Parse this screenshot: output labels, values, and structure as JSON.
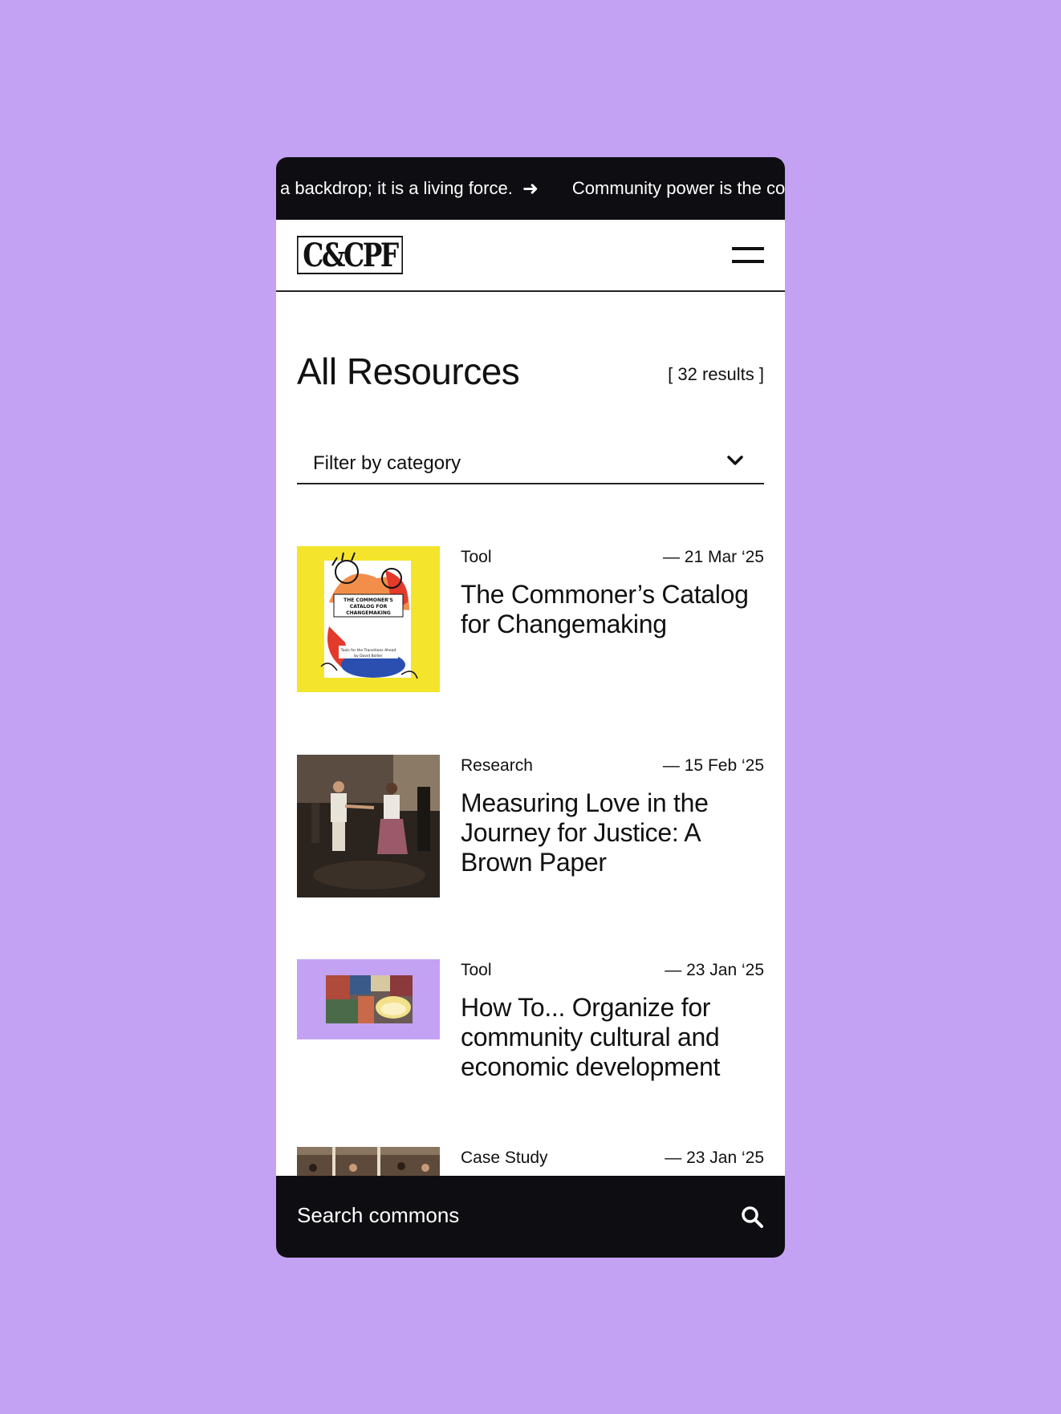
{
  "ticker": {
    "item1": "a backdrop; it is a living force.",
    "item2": "Community power is the cor"
  },
  "header": {
    "logo_text": "C&CPF",
    "menu_icon": "hamburger-menu-icon"
  },
  "main": {
    "title": "All Resources",
    "results": "[ 32 results ]",
    "filter_label": "Filter by category"
  },
  "resources": [
    {
      "category": "Tool",
      "date": "— 21 Mar ‘25",
      "title": "The Commoner’s Catalog for Changemaking"
    },
    {
      "category": "Research",
      "date": "— 15 Feb ‘25",
      "title": "Measuring Love in the Journey for Justice: A Brown Paper"
    },
    {
      "category": "Tool",
      "date": "— 23 Jan ‘25",
      "title": "How To... Organize for community cultural and economic development"
    },
    {
      "category": "Case Study",
      "date": "— 23 Jan ‘25",
      "title": ""
    }
  ],
  "thumb_text": {
    "catalog_title": "THE COMMONER'S CATALOG FOR CHANGEMAKING",
    "catalog_sub": "Tools for the Transitions Ahead",
    "catalog_author": "by David Bollier"
  },
  "search": {
    "placeholder": "Search commons"
  },
  "colors": {
    "background": "#c3a2f3",
    "dark": "#0e0e12",
    "catalog_yellow": "#f4e52c"
  }
}
